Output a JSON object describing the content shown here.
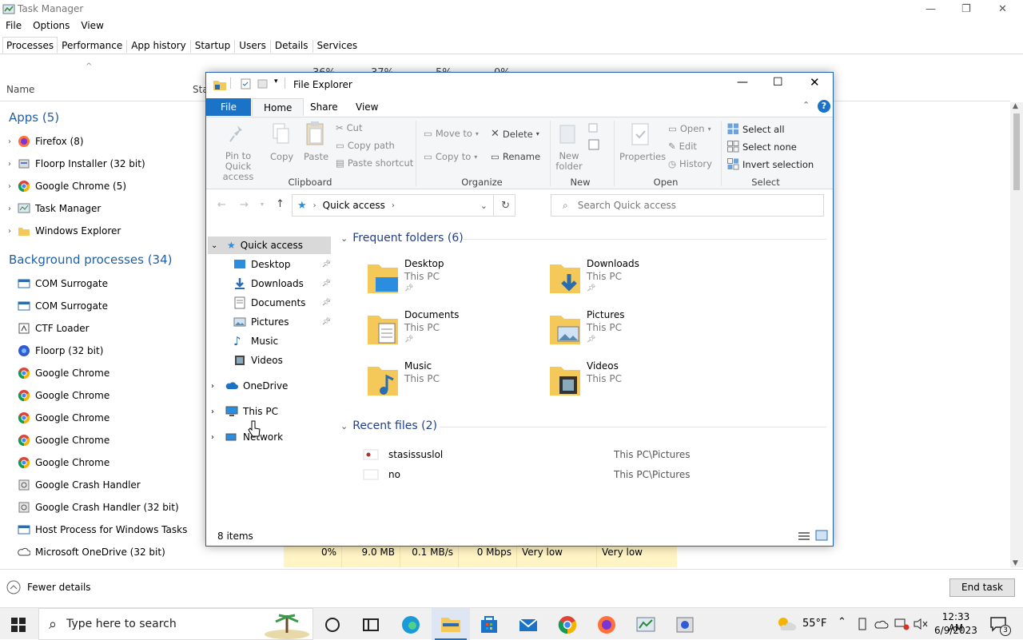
{
  "tm": {
    "title": "Task Manager",
    "menu": [
      "File",
      "Options",
      "View"
    ],
    "tabs": [
      "Processes",
      "Performance",
      "App history",
      "Startup",
      "Users",
      "Details",
      "Services"
    ],
    "col_name": "Name",
    "col_status_partial": "Sta",
    "header_pct_partial": [
      "36%",
      "37%",
      "5%",
      "0%"
    ],
    "apps_section": "Apps (5)",
    "apps": [
      "Firefox (8)",
      "Floorp Installer (32 bit)",
      "Google Chrome (5)",
      "Task Manager",
      "Windows Explorer"
    ],
    "bg_section": "Background processes (34)",
    "bg": [
      "COM Surrogate",
      "COM Surrogate",
      "CTF Loader",
      "Floorp (32 bit)",
      "Google Chrome",
      "Google Chrome",
      "Google Chrome",
      "Google Chrome",
      "Google Chrome",
      "Google Crash Handler",
      "Google Crash Handler (32 bit)",
      "Host Process for Windows Tasks",
      "Microsoft OneDrive (32 bit)"
    ],
    "last_row": {
      "cpu": "0%",
      "mem": "9.0 MB",
      "disk": "0.1 MB/s",
      "net": "0 Mbps",
      "power": "Very low",
      "power_trend": "Very low"
    },
    "fewer_details": "Fewer details",
    "end_task": "End task"
  },
  "fe": {
    "title": "File Explorer",
    "tabs": {
      "file": "File",
      "home": "Home",
      "share": "Share",
      "view": "View"
    },
    "ribbon": {
      "pin": "Pin to Quick access",
      "copy": "Copy",
      "paste": "Paste",
      "cut": "Cut",
      "copy_path": "Copy path",
      "paste_shortcut": "Paste shortcut",
      "clipboard": "Clipboard",
      "move_to": "Move to",
      "copy_to": "Copy to",
      "delete": "Delete",
      "rename": "Rename",
      "organize": "Organize",
      "new_folder": "New folder",
      "new": "New",
      "properties": "Properties",
      "open": "Open",
      "edit": "Edit",
      "history": "History",
      "open_group": "Open",
      "select_all": "Select all",
      "select_none": "Select none",
      "invert_selection": "Invert selection",
      "select": "Select"
    },
    "address": "Quick access",
    "search_placeholder": "Search Quick access",
    "nav": {
      "quick_access": "Quick access",
      "items": [
        "Desktop",
        "Downloads",
        "Documents",
        "Pictures",
        "Music",
        "Videos"
      ],
      "onedrive": "OneDrive",
      "this_pc": "This PC",
      "network": "Network"
    },
    "frequent_header": "Frequent folders (6)",
    "folders": [
      {
        "name": "Desktop",
        "loc": "This PC"
      },
      {
        "name": "Downloads",
        "loc": "This PC"
      },
      {
        "name": "Documents",
        "loc": "This PC"
      },
      {
        "name": "Pictures",
        "loc": "This PC"
      },
      {
        "name": "Music",
        "loc": "This PC"
      },
      {
        "name": "Videos",
        "loc": "This PC"
      }
    ],
    "recent_header": "Recent files (2)",
    "recent": [
      {
        "name": "stasissuslol",
        "path": "This PC\\Pictures"
      },
      {
        "name": "no",
        "path": "This PC\\Pictures"
      }
    ],
    "status": "8 items"
  },
  "taskbar": {
    "search_placeholder": "Type here to search",
    "weather": "55°F",
    "time": "12:33 AM",
    "date": "6/9/2023",
    "notif_count": "3"
  },
  "colors": {
    "accent": "#1a73c6",
    "section_blue": "#1f5fa6",
    "highlight_yellow": "#fff4c4",
    "folder": "#f5c85a"
  }
}
